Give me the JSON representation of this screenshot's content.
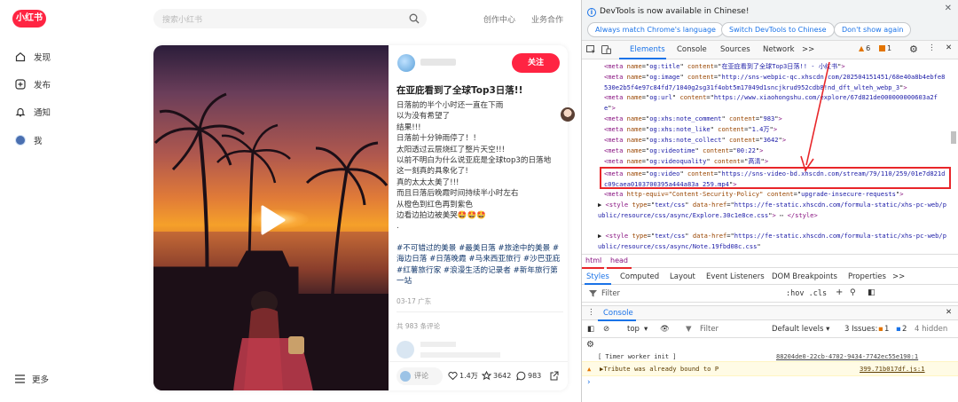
{
  "site": {
    "logo_text": "小红书",
    "search_placeholder": "搜索小红书",
    "topnav": [
      "创作中心",
      "业务合作"
    ],
    "sidebar": [
      {
        "label": "发现",
        "icon": "home-icon"
      },
      {
        "label": "发布",
        "icon": "plus-square-icon"
      },
      {
        "label": "通知",
        "icon": "bell-icon"
      },
      {
        "label": "我",
        "icon": "avatar"
      }
    ],
    "more_label": "更多"
  },
  "note": {
    "follow_label": "关注",
    "title": "在亚庇看到了全球Top3日落!!",
    "body": [
      "日落前的半个小时还一直在下雨",
      "以为没有希望了",
      "结果!!!",
      "日落前十分钟雨停了！！",
      "太阳透过云层烧红了整片天空!!!",
      "以前不明白为什么说亚庇是全球top3的日落地",
      "这一刻真的具象化了!",
      "真的太太太美了!!!",
      "而且日落后晚霞时间持续半小时左右",
      "从橙色到红色再到紫色",
      "边看边拍边被美哭🤩🤩🤩",
      "."
    ],
    "tags": "#不可错过的美景 #最美日落 #旅途中的美景 #海边日落 #日落晚霞 #马来西亚旅行 #沙巴亚庇 #红薯旅行家 #浪漫生活的记录者 #新年旅行第一站",
    "date": "03-17 广东",
    "comment_count": "共 983 条评论",
    "comment_button": "评论",
    "likes": "1.4万",
    "collects": "3642",
    "comments": "983"
  },
  "devtools": {
    "banner_message": "DevTools is now available in Chinese!",
    "banner_buttons": [
      "Always match Chrome's language",
      "Switch DevTools to Chinese",
      "Don't show again"
    ],
    "tabs": [
      "Elements",
      "Console",
      "Sources",
      "Network",
      ">>"
    ],
    "warnings": "6",
    "errors": "1",
    "code_lines": [
      {
        "tag": "<meta",
        "name": "og:title",
        "content": "在亚庇看到了全球Top3日落!! - 小红书"
      },
      {
        "tag": "<meta",
        "name": "og:image",
        "content": "http://sns-webpic-qc.xhscdn.com/202504151451/68e40a8b4ebfe8530e2b5f4e97c84fd7/1040g2sg31f4obt5m17049d1sncjkrud952cdb8!nd_dft_wlteh_webp_3"
      },
      {
        "tag": "<meta",
        "name": "og:url",
        "content": "https://www.xiaohongshu.com/explore/67d821de000000000603a2fe"
      },
      {
        "tag": "<meta",
        "name": "og:xhs:note_comment",
        "content": "983"
      },
      {
        "tag": "<meta",
        "name": "og:xhs:note_like",
        "content": "1.4万"
      },
      {
        "tag": "<meta",
        "name": "og:xhs:note_collect",
        "content": "3642"
      },
      {
        "tag": "<meta",
        "name": "og:videotime",
        "content": "00:22"
      },
      {
        "tag": "<meta",
        "name": "og:videoquality",
        "content": "高清"
      },
      {
        "tag": "<meta",
        "name": "og:video",
        "content": "https://sns-video-bd.xhscdn.com/stream/79/110/259/01e7d821dc09caea0103700395a444a83a_259.mp4"
      },
      {
        "tag": "<meta",
        "name": "http-equiv=\"Content-Security-Policy\"",
        "content": "upgrade-insecure-requests"
      },
      {
        "tag": "<style",
        "name": "text/css",
        "content": "https://fe-static.xhscdn.com/formula-static/xhs-pc-web/public/resource/css/async/Explore.30c1e8ce.css"
      },
      {
        "tag": "<style",
        "name": "text/css",
        "content": "https://fe-static.xhscdn.com/formula-static/xhs-pc-web/public/resource/css/async/Note.19fbd08c.css"
      }
    ],
    "breadcrumb": [
      "html",
      "head"
    ],
    "style_tabs": [
      "Styles",
      "Computed",
      "Layout",
      "Event Listeners",
      "DOM Breakpoints",
      "Properties",
      ">>"
    ],
    "filter_placeholder": "Filter",
    "filter_flags": ":hov  .cls",
    "console_tab": "Console",
    "console_context": "top",
    "console_filter": "Filter",
    "default_levels": "Default levels ▾",
    "issues_label": "3 Issues:",
    "issues_warn": "1",
    "issues_info": "2",
    "hidden": "4 hidden",
    "log1_text": "[ Timer worker init ]",
    "log1_src": "88204de0-22cb-4702-9434-7742ec55e190:1",
    "log2_text": "▶Tribute was already bound to P",
    "log2_src": "399.71b017df.js:1"
  },
  "colors": {
    "brand": "#ff2442",
    "devtools_accent": "#1a73e8",
    "highlight": "#e8262a"
  }
}
